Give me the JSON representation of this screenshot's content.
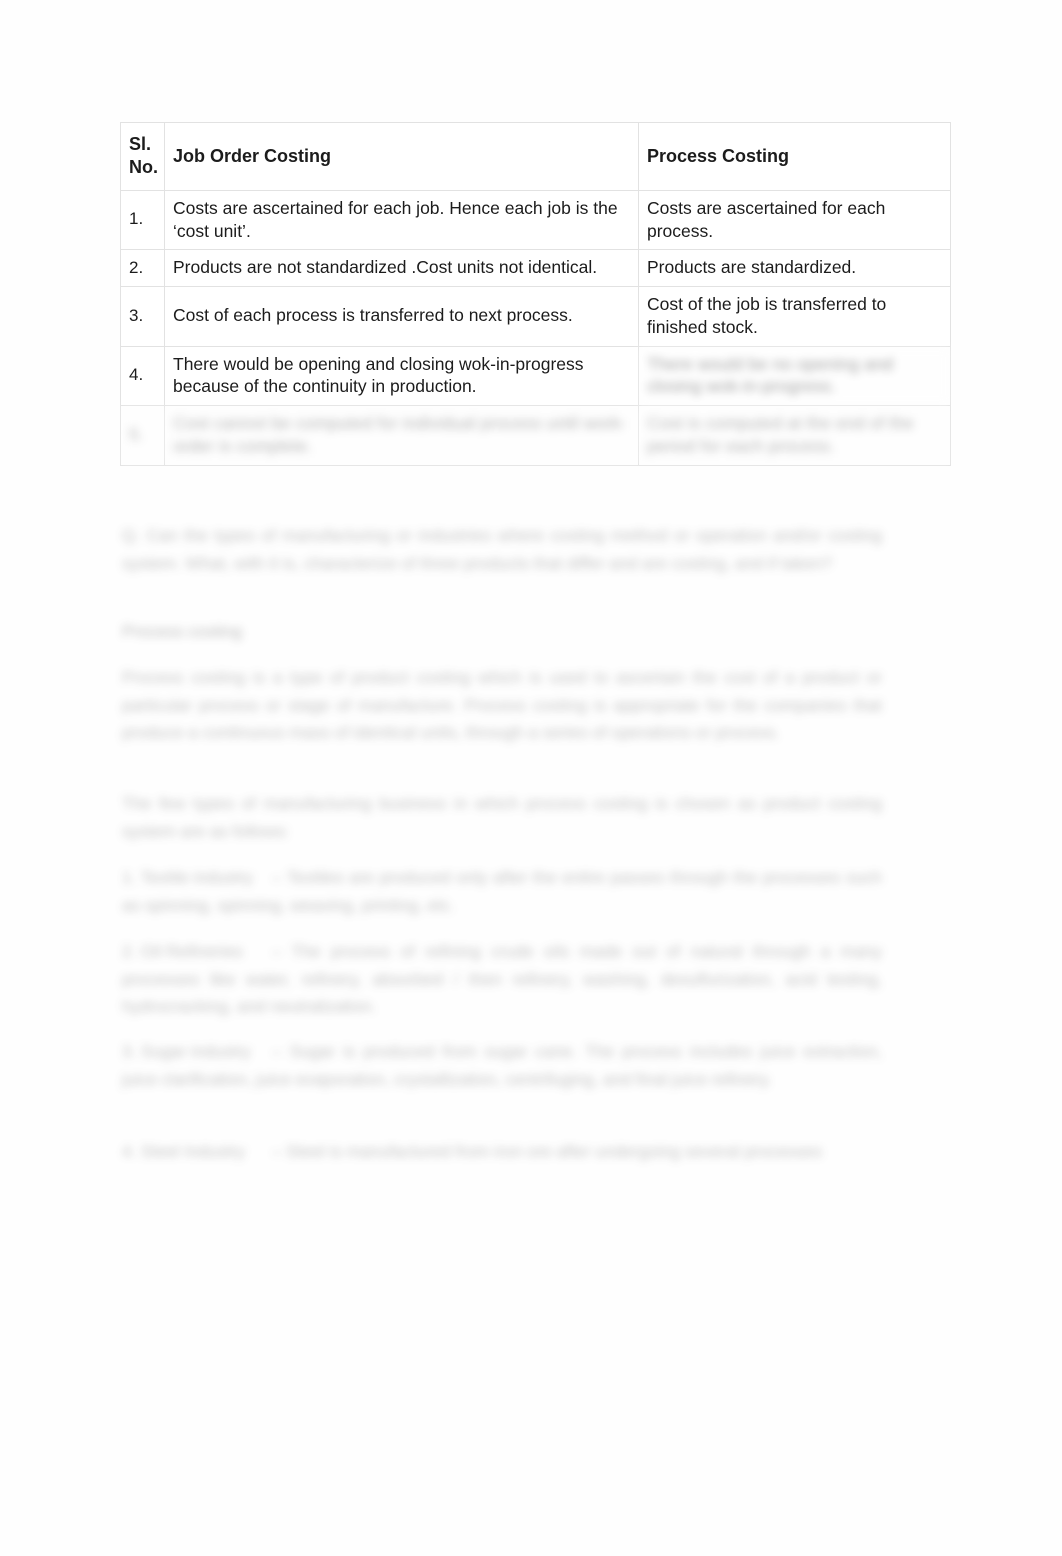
{
  "document": {
    "type": "text-document-page",
    "page_background": "#fefefe",
    "text_color": "#1c1c1c",
    "border_color": "#e2e2e2"
  },
  "table": {
    "name": "job-order-vs-process-costing",
    "headers": {
      "no_line1": "Sl.",
      "no_line2": "No.",
      "col_job": "Job Order Costing",
      "col_process": "Process Costing"
    },
    "rows": [
      {
        "no": "1.",
        "job": "Costs are ascertained for each job. Hence each job is the ‘cost unit’.",
        "process": "Costs are ascertained for each process.",
        "job_blurred": false,
        "process_blurred": false
      },
      {
        "no": "2.",
        "job": "Products are not standardized .Cost units not identical.",
        "process": "Products are standardized.",
        "job_blurred": false,
        "process_blurred": false
      },
      {
        "no": "3.",
        "job": "Cost of each process is transferred to next process.",
        "process": "Cost of the job is transferred to finished stock.",
        "job_blurred": false,
        "process_blurred": false
      },
      {
        "no": "4.",
        "job": "There would be opening and closing wok-in-progress because of the continuity in production.",
        "process": "There would be no opening and closing wok-in-progress.",
        "job_blurred": false,
        "process_blurred": true
      },
      {
        "no": "5.",
        "job": "Cost cannot be computed for individual process until work-order is complete.",
        "process": "Cost is computed at the end of the period for each process.",
        "job_blurred": true,
        "process_blurred": true
      }
    ]
  },
  "body": {
    "blurred": true,
    "question": "Q. Can the types of manufacturing or industries where costing method or operation and/or costing system. What, with it is, characterize of three products that differ and are costing, and if taken?",
    "section_heading": "Process costing",
    "paragraphs": [
      "Process costing is a type of product costing which is used to ascertain the cost of a product or particular process or stage of manufacture. Process costing is appropriate for the companies that produce a continuous mass of identical units, through a series of operations or process.",
      "The few types of manufacturing business in which process costing is chosen as product costing system are as follows:"
    ],
    "list": [
      {
        "tag": "1. Textile industry",
        "text": "– Textiles are produced only after the entire passes through the processes such as spinning, spinning, weaving, printing, etc."
      },
      {
        "tag": "2. Oil Refineries",
        "text": "– The process of refining crude oils made out of natural through a many processes like water, refinery, absorbed / then refinery, washing, desulfurization, acid testing, hydrocracking, and neutralization."
      },
      {
        "tag": "3. Sugar industry",
        "text": "– Sugar is produced from sugar cane. The process includes juice extraction, juice clarification, juice evaporation, crystallization, centrifuging, and final juice refinery."
      },
      {
        "tag": "4. Steel Industry",
        "text": "– Steel is manufactured from iron ore after undergoing several processes"
      }
    ]
  }
}
